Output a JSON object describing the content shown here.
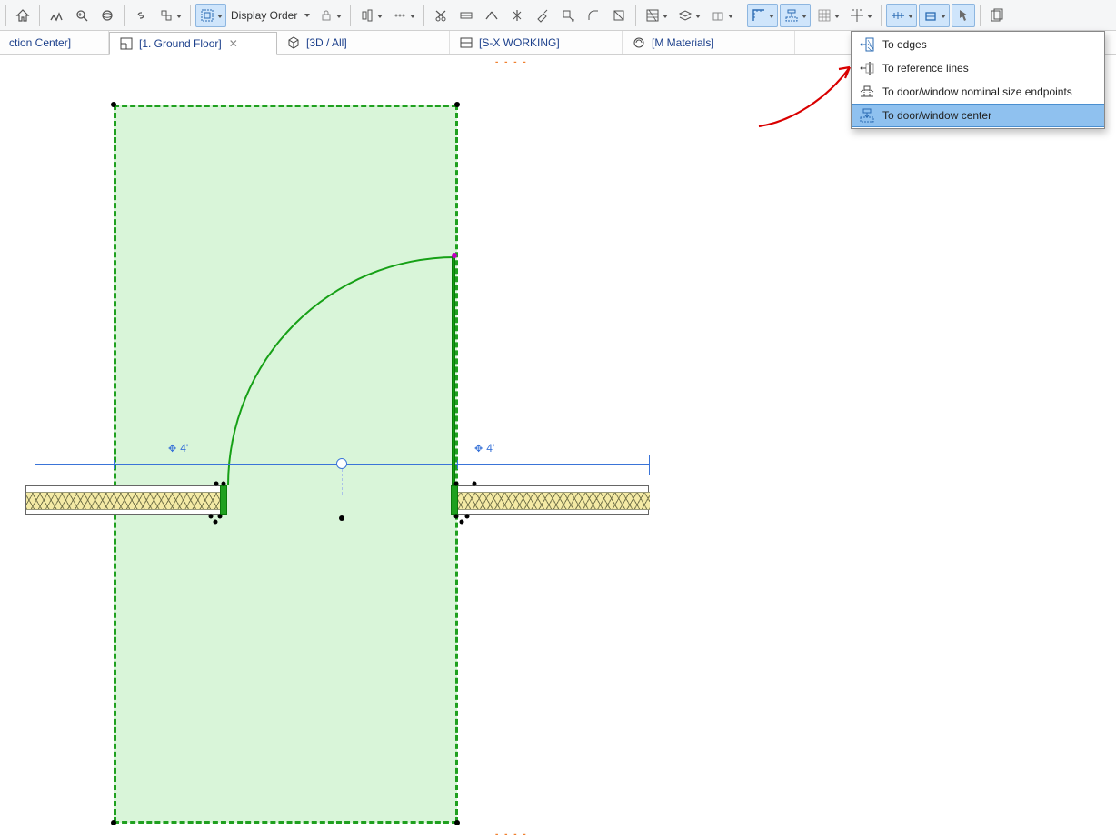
{
  "toolbar": {
    "display_order_label": "Display Order"
  },
  "tabs": {
    "t0": {
      "label": "ction Center]"
    },
    "t1": {
      "label": "[1. Ground Floor]"
    },
    "t2": {
      "label": "[3D / All]"
    },
    "t3": {
      "label": "[S-X WORKING]"
    },
    "t4": {
      "label": "[M Materials]"
    }
  },
  "dropdown": {
    "item0": "To edges",
    "item1": "To reference lines",
    "item2": "To door/window nominal size endpoints",
    "item3": "To door/window center"
  },
  "dimensions": {
    "left_segment": "4'",
    "right_segment": "4'"
  },
  "canvas": {
    "guide_top": "- - - -",
    "guide_bottom": "- - - -"
  }
}
